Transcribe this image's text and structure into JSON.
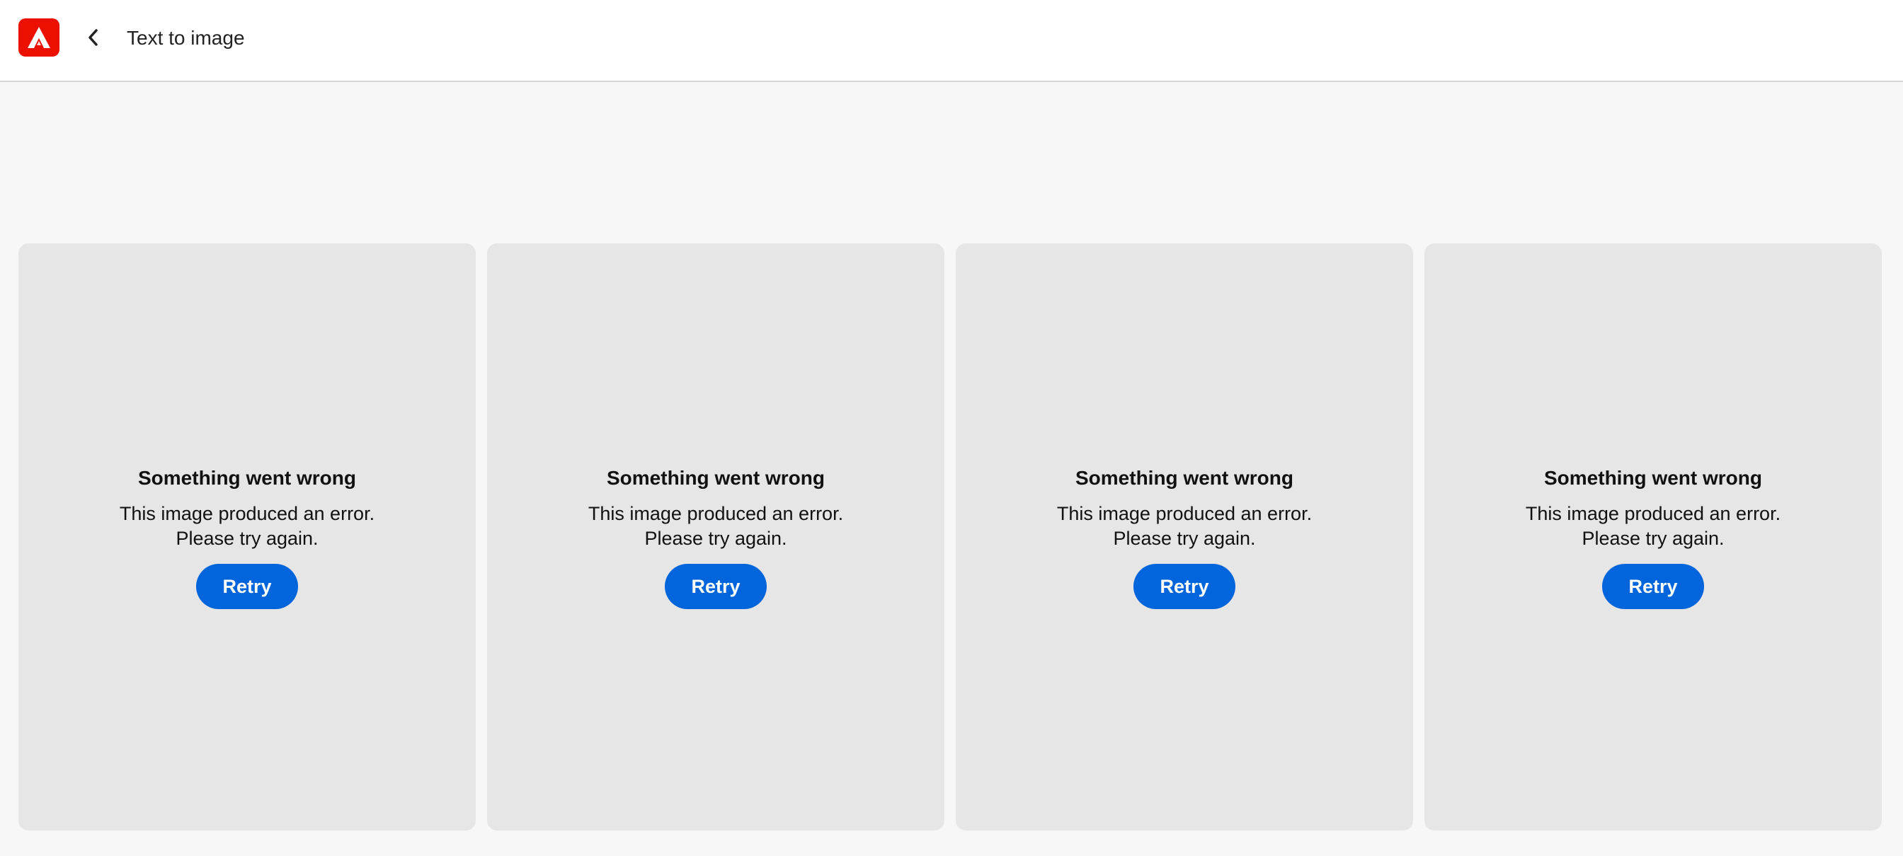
{
  "header": {
    "logo_icon": "adobe-express-logo",
    "brand_color": "#eb1000",
    "back_icon": "chevron-left-icon",
    "title": "Text to image"
  },
  "results": [
    {
      "heading": "Something went wrong",
      "message": "This image produced an error. Please try again.",
      "retry_label": "Retry"
    },
    {
      "heading": "Something went wrong",
      "message": "This image produced an error. Please try again.",
      "retry_label": "Retry"
    },
    {
      "heading": "Something went wrong",
      "message": "This image produced an error. Please try again.",
      "retry_label": "Retry"
    },
    {
      "heading": "Something went wrong",
      "message": "This image produced an error. Please try again.",
      "retry_label": "Retry"
    }
  ],
  "colors": {
    "accent": "#0265dc",
    "card_bg": "#e6e6e6",
    "page_bg": "#f7f7f7"
  }
}
